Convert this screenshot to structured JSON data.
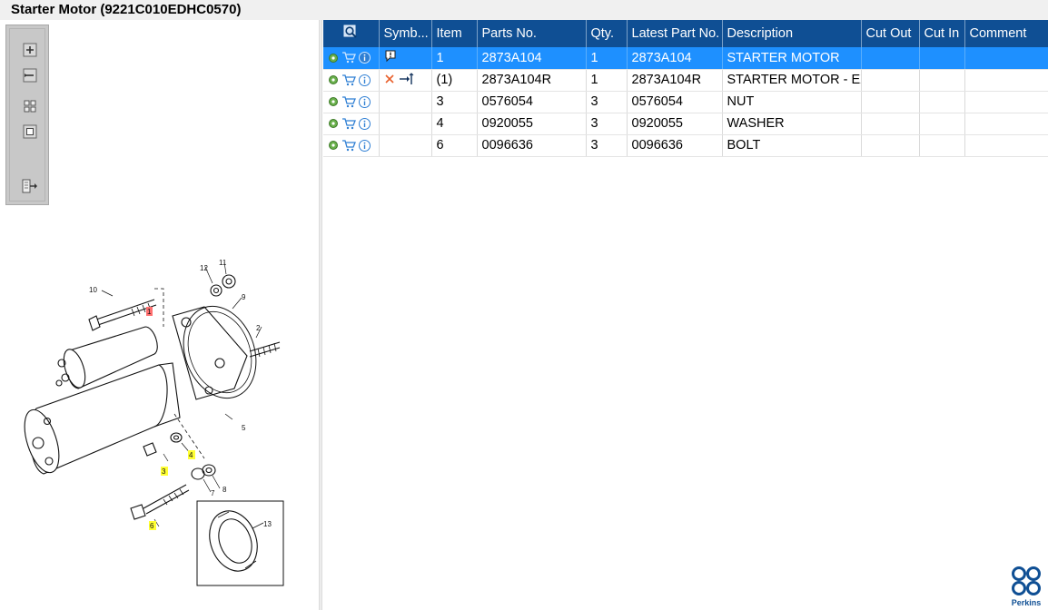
{
  "window": {
    "title": "Starter Motor (9221C010EDHC0570)"
  },
  "toolbar": {
    "buttons": [
      {
        "name": "zoom-in",
        "icon": "zoom-in-icon"
      },
      {
        "name": "zoom-out",
        "icon": "zoom-out-icon"
      },
      {
        "name": "fit-all",
        "icon": "fit-all-icon"
      },
      {
        "name": "fit-window",
        "icon": "fit-window-icon"
      },
      {
        "name": "export",
        "icon": "export-icon"
      }
    ]
  },
  "drawing": {
    "callouts": [
      "1",
      "2",
      "3",
      "4",
      "5",
      "6",
      "7",
      "8",
      "9",
      "10",
      "11",
      "12",
      "13"
    ],
    "highlighted": [
      "1",
      "3",
      "4",
      "6"
    ]
  },
  "grid": {
    "columns": [
      "",
      "Symb...",
      "Item",
      "Parts No.",
      "Qty.",
      "Latest Part No.",
      "Description",
      "Cut Out",
      "Cut In",
      "Comment"
    ],
    "rows": [
      {
        "item": "1",
        "parts_no": "2873A104",
        "qty": "1",
        "latest": "2873A104",
        "description": "STARTER MOTOR",
        "cut_out": "",
        "cut_in": "",
        "comment": "",
        "symbol": "note-icon"
      },
      {
        "item": "(1)",
        "parts_no": "2873A104R",
        "qty": "1",
        "latest": "2873A104R",
        "description": "STARTER MOTOR - EX",
        "cut_out": "",
        "cut_in": "",
        "comment": "",
        "symbol": "exchange-icon"
      },
      {
        "item": "3",
        "parts_no": "0576054",
        "qty": "3",
        "latest": "0576054",
        "description": "NUT",
        "cut_out": "",
        "cut_in": "",
        "comment": "",
        "symbol": ""
      },
      {
        "item": "4",
        "parts_no": "0920055",
        "qty": "3",
        "latest": "0920055",
        "description": "WASHER",
        "cut_out": "",
        "cut_in": "",
        "comment": "",
        "symbol": ""
      },
      {
        "item": "6",
        "parts_no": "0096636",
        "qty": "3",
        "latest": "0096636",
        "description": "BOLT",
        "cut_out": "",
        "cut_in": "",
        "comment": "",
        "symbol": ""
      }
    ]
  },
  "branding": {
    "logo_text": "Perkins"
  },
  "colors": {
    "header": "#0f4f94",
    "selected": "#1e90ff",
    "highlight": "#ffff33",
    "highlight_red": "#ff7070"
  }
}
